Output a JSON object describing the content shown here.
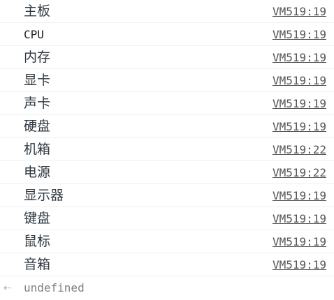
{
  "console": {
    "logs": [
      {
        "message": "主板",
        "source": "VM519:19"
      },
      {
        "message": "CPU",
        "source": "VM519:19"
      },
      {
        "message": "内存",
        "source": "VM519:19"
      },
      {
        "message": "显卡",
        "source": "VM519:19"
      },
      {
        "message": "声卡",
        "source": "VM519:19"
      },
      {
        "message": "硬盘",
        "source": "VM519:19"
      },
      {
        "message": "机箱",
        "source": "VM519:22"
      },
      {
        "message": "电源",
        "source": "VM519:22"
      },
      {
        "message": "显示器",
        "source": "VM519:19"
      },
      {
        "message": "键盘",
        "source": "VM519:19"
      },
      {
        "message": "鼠标",
        "source": "VM519:19"
      },
      {
        "message": "音箱",
        "source": "VM519:19"
      }
    ],
    "result": {
      "arrow": "⇠",
      "value": "undefined",
      "arrow_icon": "result-arrow-icon"
    }
  }
}
